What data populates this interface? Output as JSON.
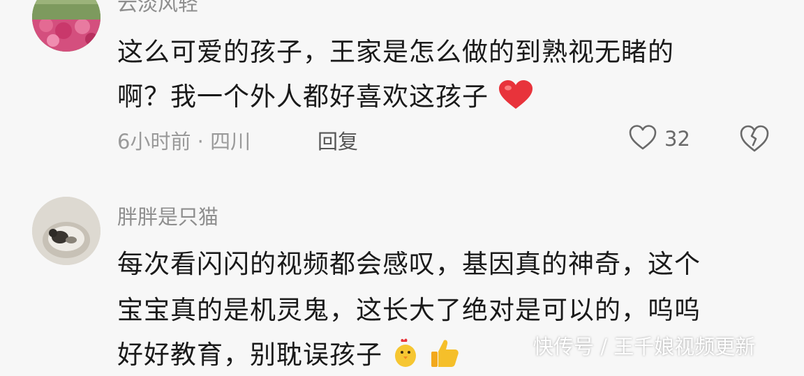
{
  "comments": [
    {
      "username": "云淡风轻",
      "lines": [
        "这么可爱的孩子，王家是怎么做的到熟视无睹的",
        "啊？我一个外人都好喜欢这孩子"
      ],
      "emoji": "red-heart-icon",
      "meta": "6小时前 · 四川",
      "reply_label": "回复",
      "like_count": "32"
    },
    {
      "username": "胖胖是只猫",
      "lines": [
        "每次看闪闪的视频都会感叹，基因真的神奇，这个",
        "宝宝真的是机灵鬼，这长大了绝对是可以的，呜呜",
        "好好教育，别耽误孩子"
      ],
      "emoji_trailing": [
        "chick-icon",
        "thumbs-up-icon"
      ]
    }
  ],
  "watermark": "快传号 / 王千娘视频更新",
  "colors": {
    "background": "#f7f7f7",
    "heart": "#e8333b",
    "meta": "#9a9a9a"
  }
}
